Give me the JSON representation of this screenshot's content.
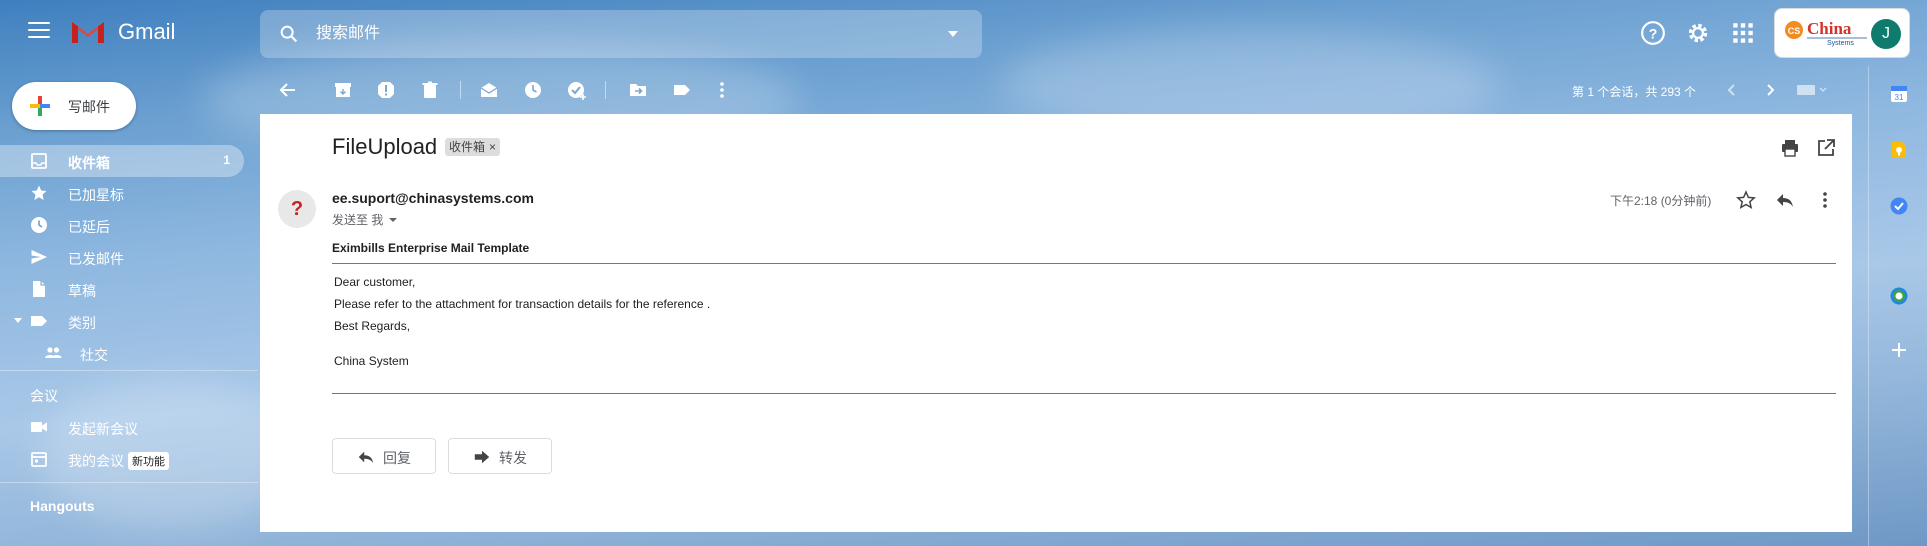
{
  "header": {
    "app_name": "Gmail",
    "search_placeholder": "搜索邮件",
    "account_logo_text": "China",
    "account_logo_sub": "Systems",
    "avatar_letter": "J"
  },
  "sidebar": {
    "compose_label": "写邮件",
    "items": [
      {
        "label": "收件箱",
        "count": "1",
        "icon": "inbox-icon"
      },
      {
        "label": "已加星标",
        "icon": "star-icon"
      },
      {
        "label": "已延后",
        "icon": "clock-icon"
      },
      {
        "label": "已发邮件",
        "icon": "send-icon"
      },
      {
        "label": "草稿",
        "icon": "draft-icon"
      },
      {
        "label": "类别",
        "icon": "label-icon"
      },
      {
        "label": "社交",
        "icon": "people-icon"
      }
    ],
    "meet_title": "会议",
    "meet_items": [
      {
        "label": "发起新会议",
        "icon": "video-icon"
      },
      {
        "label": "我的会议",
        "badge": "新功能",
        "icon": "calendar-icon"
      }
    ],
    "hangouts_title": "Hangouts"
  },
  "toolbar": {
    "pager_text": "第 1 个会话，共 293 个"
  },
  "message": {
    "subject": "FileUpload",
    "label_chip": "收件箱",
    "sender_email": "ee.suport@chinasystems.com",
    "to_me": "发送至 我",
    "timestamp": "下午2:18 (0分钟前)",
    "template_title": "Eximbills Enterprise Mail Template",
    "body_lines": [
      "Dear customer,",
      "Please refer to the attachment for transaction details for the reference .",
      "Best Regards,",
      "China System"
    ],
    "reply_label": "回复",
    "forward_label": "转发"
  },
  "colors": {
    "gmail_red": "#EA4335",
    "avatar_green": "#0f7b6c",
    "sky_blue": "#6a9fd0"
  }
}
